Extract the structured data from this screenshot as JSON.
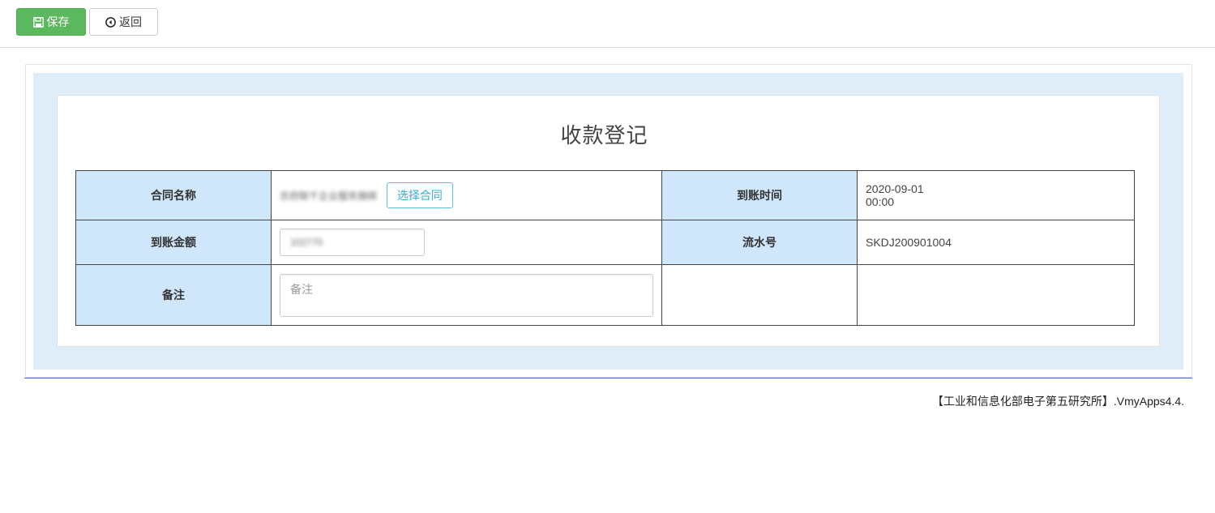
{
  "toolbar": {
    "save_label": "保存",
    "back_label": "返回",
    "save_icon": "floppy-disk-icon",
    "back_icon": "circle-arrow-left-icon",
    "save_color": "#5cb85c"
  },
  "form": {
    "title": "收款登记",
    "contract_name_label": "合同名称",
    "contract_name_value": "京府联千企业服务捆绑",
    "select_contract_label": "选择合同",
    "arrival_time_label": "到账时间",
    "arrival_date": "2020-09-01",
    "arrival_clock": "00:00",
    "amount_label": "到账金额",
    "amount_value": "102770",
    "serial_label": "流水号",
    "serial_value": "SKDJ200901004",
    "remark_label": "备注",
    "remark_placeholder": "备注",
    "label_bg_color": "#cfe6fb"
  },
  "footer": {
    "text": "【工业和信息化部电子第五研究所】.VmyApps4.4."
  }
}
